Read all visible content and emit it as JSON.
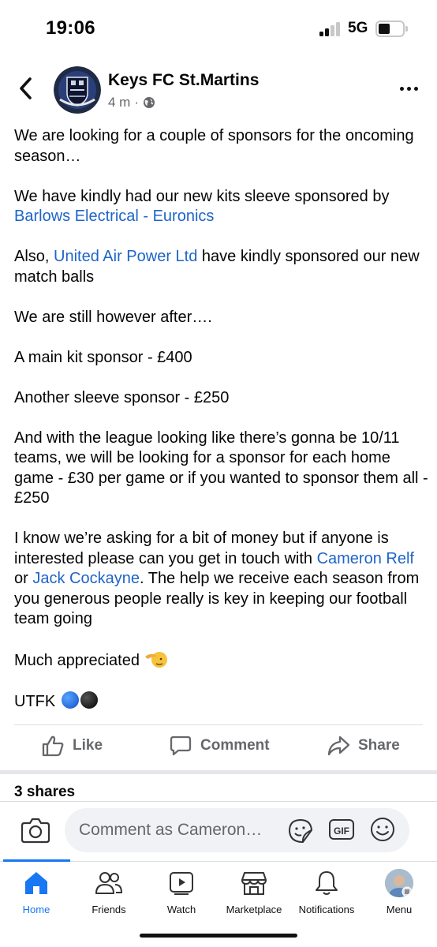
{
  "status_bar": {
    "time": "19:06",
    "network": "5G"
  },
  "header": {
    "page_name": "Keys FC St.Martins",
    "timestamp": "4 m",
    "separator": "·"
  },
  "post": {
    "p1": "We are looking for a couple of sponsors for the oncoming season…",
    "p2_text": "We have kindly had our new kits sleeve sponsored by ",
    "p2_link": "Barlows Electrical - Euronics",
    "p3_prefix": "Also, ",
    "p3_link": "United Air Power Ltd",
    "p3_suffix": " have kindly sponsored our new match balls",
    "p4": "We are still however after….",
    "p5": "A main kit sponsor - £400",
    "p6": "Another sleeve sponsor - £250",
    "p7": "And with the league looking like there’s gonna be 10/11 teams, we will be looking for a sponsor for each home game - £30 per game or if you wanted to sponsor them all - £250",
    "p8_text": "I know we’re asking for a bit of money but if anyone is interested please can you get in touch with ",
    "p8_link1": "Cameron Relf",
    "p8_mid": " or ",
    "p8_link2": "Jack Cockayne",
    "p8_suffix": ". The help we receive each season from you generous people really is key in keeping our football team going",
    "p9": "Much appreciated ",
    "p10": "UTFK "
  },
  "actions": {
    "like": "Like",
    "comment": "Comment",
    "share": "Share"
  },
  "shares_count": "3 shares",
  "composer": {
    "placeholder": "Comment as Cameron…",
    "gif": "GIF"
  },
  "nav": {
    "home": "Home",
    "friends": "Friends",
    "watch": "Watch",
    "marketplace": "Marketplace",
    "notifications": "Notifications",
    "menu": "Menu"
  },
  "colors": {
    "link": "#1e64c8",
    "accent": "#1877f2",
    "muted": "#65676b"
  },
  "icons": [
    "back-icon",
    "more-icon",
    "globe-icon",
    "like-icon",
    "comment-icon",
    "share-icon",
    "camera-icon",
    "sticker-icon",
    "gif-icon",
    "smile-icon",
    "home-icon",
    "friends-icon",
    "watch-icon",
    "marketplace-icon",
    "notifications-icon"
  ]
}
